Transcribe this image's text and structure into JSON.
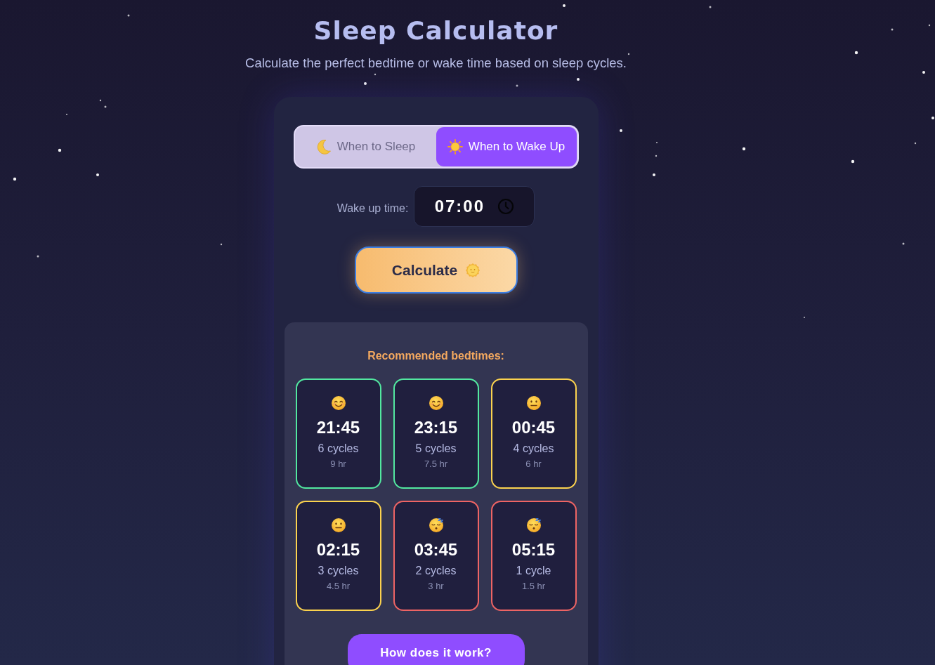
{
  "header": {
    "title": "Sleep Calculator",
    "subtitle": "Calculate the perfect bedtime or wake time based on sleep cycles."
  },
  "mode_tabs": [
    {
      "label": "When to Sleep",
      "kind": "moon",
      "selected": false
    },
    {
      "label": "When to Wake Up",
      "kind": "sun",
      "selected": true
    }
  ],
  "wake_time": {
    "label": "Wake up time:",
    "value": "07:00"
  },
  "calculate_button": {
    "label": "Calculate"
  },
  "results": {
    "heading": "Recommended bedtimes:",
    "options": [
      {
        "kind": "smile",
        "color": "#52e8a0",
        "time": "21:45",
        "cycles": "6 cycles",
        "duration": "9 hr"
      },
      {
        "kind": "smile",
        "color": "#52e8a0",
        "time": "23:15",
        "cycles": "5 cycles",
        "duration": "7.5 hr"
      },
      {
        "kind": "neutral",
        "color": "#fbd24e",
        "time": "00:45",
        "cycles": "4 cycles",
        "duration": "6 hr"
      },
      {
        "kind": "neutral",
        "color": "#fbd24e",
        "time": "02:15",
        "cycles": "3 cycles",
        "duration": "4.5 hr"
      },
      {
        "kind": "sleepy",
        "color": "#ee6464",
        "time": "03:45",
        "cycles": "2 cycles",
        "duration": "3 hr"
      },
      {
        "kind": "sleepy",
        "color": "#ee6464",
        "time": "05:15",
        "cycles": "1 cycle",
        "duration": "1.5 hr"
      }
    ]
  },
  "help_button": {
    "label": "How does it work?"
  }
}
